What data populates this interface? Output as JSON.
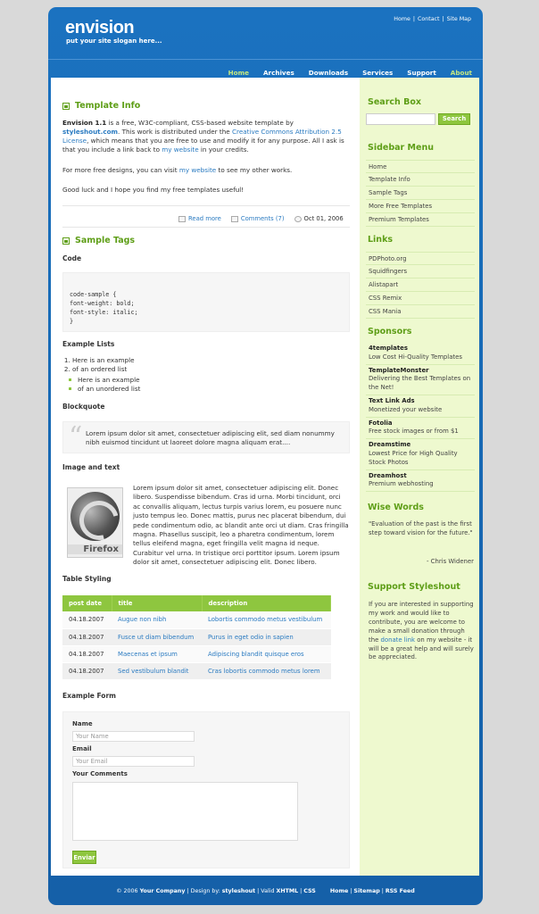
{
  "header": {
    "logo": "envision",
    "slogan": "put your site slogan here...",
    "top_links": [
      "Home",
      "Contact",
      "Site Map"
    ]
  },
  "nav": {
    "items": [
      "Home",
      "Archives",
      "Downloads",
      "Services",
      "Support",
      "About"
    ],
    "active": [
      "Home",
      "About"
    ]
  },
  "content": {
    "template_info": {
      "title": "Template Info",
      "p1_bold": "Envision 1.1",
      "p1_a": " is a free, W3C-compliant, CSS-based website template by ",
      "p1_link1": "styleshout.com",
      "p1_b": ". This work is distributed under the ",
      "p1_link2": "Creative Commons Attribution 2.5 License",
      "p1_c": ", which means that you are free to use and modify it for any purpose. All I ask is that you include a link back to ",
      "p1_link3": "my website",
      "p1_d": " in your credits.",
      "p2_a": "For more free designs, you can visit ",
      "p2_link": "my website",
      "p2_b": " to see my other works.",
      "p3": "Good luck and I hope you find my free templates useful!",
      "read_more": "Read more",
      "comments": "Comments (7)",
      "date": "Oct 01, 2006"
    },
    "sample_tags": {
      "title": "Sample Tags",
      "code_heading": "Code",
      "code_lines": [
        "code-sample {",
        "font-weight: bold;",
        "font-style: italic;",
        "}"
      ],
      "lists_heading": "Example Lists",
      "ordered": [
        "Here is an example",
        "of an ordered list"
      ],
      "unordered": [
        "Here is an example",
        "of an unordered list"
      ],
      "blockquote_heading": "Blockquote",
      "quote": "Lorem ipsum dolor sit amet, consectetuer adipiscing elit, sed diam nonummy nibh euismod tincidunt ut laoreet dolore magna aliquam erat....",
      "image_heading": "Image and text",
      "image_caption": "Firefox",
      "image_text": "Lorem ipsum dolor sit amet, consectetuer adipiscing elit. Donec libero. Suspendisse bibendum. Cras id urna. Morbi tincidunt, orci ac convallis aliquam, lectus turpis varius lorem, eu posuere nunc justo tempus leo. Donec mattis, purus nec placerat bibendum, dui pede condimentum odio, ac blandit ante orci ut diam. Cras fringilla magna. Phasellus suscipit, leo a pharetra condimentum, lorem tellus eleifend magna, eget fringilla velit magna id neque. Curabitur vel urna. In tristique orci porttitor ipsum. Lorem ipsum dolor sit amet, consectetuer adipiscing elit. Donec libero.",
      "table_heading": "Table Styling",
      "table_headers": [
        "post date",
        "title",
        "description"
      ],
      "table_rows": [
        [
          "04.18.2007",
          "Augue non nibh",
          "Lobortis commodo metus vestibulum"
        ],
        [
          "04.18.2007",
          "Fusce ut diam bibendum",
          "Purus in eget odio in sapien"
        ],
        [
          "04.18.2007",
          "Maecenas et ipsum",
          "Adipiscing blandit quisque eros"
        ],
        [
          "04.18.2007",
          "Sed vestibulum blandit",
          "Cras lobortis commodo metus lorem"
        ]
      ],
      "form_heading": "Example Form",
      "form": {
        "name_label": "Name",
        "name_placeholder": "Your Name",
        "email_label": "Email",
        "email_placeholder": "Your Email",
        "comments_label": "Your Comments",
        "submit": "Enviar"
      }
    }
  },
  "sidebar": {
    "search_title": "Search Box",
    "search_button": "Search",
    "menu_title": "Sidebar Menu",
    "menu": [
      "Home",
      "Template Info",
      "Sample Tags",
      "More Free Templates",
      "Premium Templates"
    ],
    "links_title": "Links",
    "links": [
      "PDPhoto.org",
      "Squidfingers",
      "Alistapart",
      "CSS Remix",
      "CSS Mania"
    ],
    "sponsors_title": "Sponsors",
    "sponsors": [
      {
        "name": "4templates",
        "desc": "Low Cost Hi-Quality Templates"
      },
      {
        "name": "TemplateMonster",
        "desc": "Delivering the Best Templates on the Net!"
      },
      {
        "name": "Text Link Ads",
        "desc": "Monetized your website"
      },
      {
        "name": "Fotolia",
        "desc": "Free stock images or from $1"
      },
      {
        "name": "Dreamstime",
        "desc": "Lowest Price for High Quality Stock Photos"
      },
      {
        "name": "Dreamhost",
        "desc": "Premium webhosting"
      }
    ],
    "wise_title": "Wise Words",
    "wise_quote": "\"Evaluation of the past is the first step toward vision for the future.\"",
    "wise_author": "- Chris Widener",
    "support_title": "Support Styleshout",
    "support_a": "If you are interested in supporting my work and would like to contribute, you are welcome to make a small donation through the ",
    "support_link": "donate link",
    "support_b": " on my website - it will be a great help and will surely be appreciated."
  },
  "footer": {
    "copyright": "© 2006",
    "company": "Your Company",
    "design_by_label": "Design by:",
    "designer": "styleshout",
    "valid_label": "Valid",
    "xhtml": "XHTML",
    "css": "CSS",
    "links": [
      "Home",
      "Sitemap",
      "RSS Feed"
    ]
  }
}
